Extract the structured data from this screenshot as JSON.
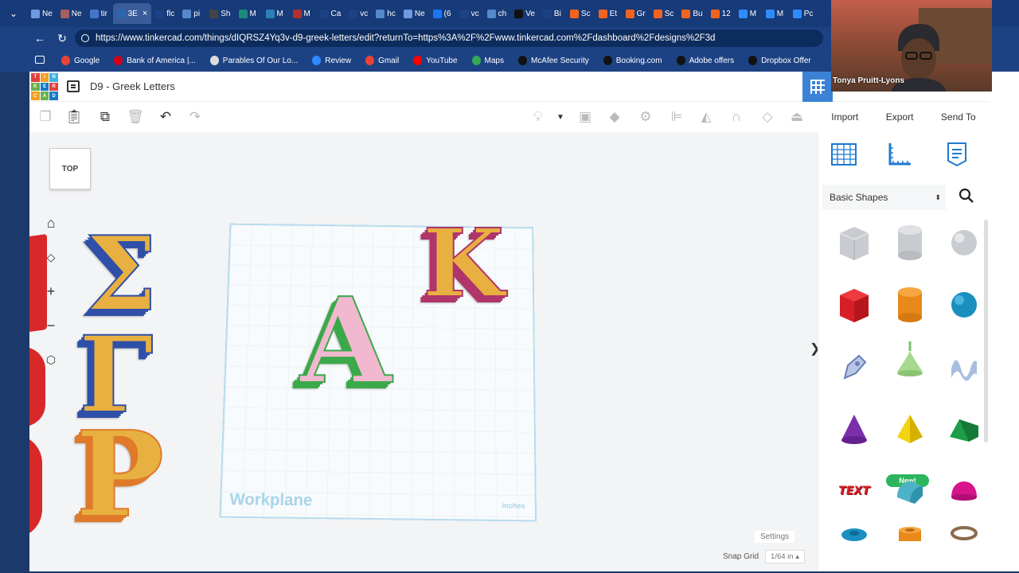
{
  "browser": {
    "tabs": [
      {
        "label": "Ne",
        "color": "#6d9ae0"
      },
      {
        "label": "Ne",
        "color": "#a85f5f"
      },
      {
        "label": "tir",
        "color": "#4477cc"
      },
      {
        "label": "3E",
        "color": "#2b66b0",
        "active": true
      },
      {
        "label": "flc",
        "color": "#1d4284"
      },
      {
        "label": "pi",
        "color": "#5588cc"
      },
      {
        "label": "Sh",
        "color": "#444444"
      },
      {
        "label": "M",
        "color": "#1b8a7a"
      },
      {
        "label": "M",
        "color": "#2a7fb8"
      },
      {
        "label": "M",
        "color": "#b33030"
      },
      {
        "label": "Ca",
        "color": "#1d4284"
      },
      {
        "label": "vc",
        "color": "#1d4284"
      },
      {
        "label": "hc",
        "color": "#5588cc"
      },
      {
        "label": "Ne",
        "color": "#6d9ae0"
      },
      {
        "label": "(6",
        "color": "#1877f2"
      },
      {
        "label": "vc",
        "color": "#1d4284"
      },
      {
        "label": "ch",
        "color": "#5588cc"
      },
      {
        "label": "Ve",
        "color": "#111111"
      },
      {
        "label": "Bi",
        "color": "#1d4284"
      },
      {
        "label": "Sc",
        "color": "#f1641e"
      },
      {
        "label": "Et",
        "color": "#f1641e"
      },
      {
        "label": "Gr",
        "color": "#f1641e"
      },
      {
        "label": "Sc",
        "color": "#f1641e"
      },
      {
        "label": "Bu",
        "color": "#f1641e"
      },
      {
        "label": "12",
        "color": "#f1641e"
      },
      {
        "label": "M",
        "color": "#2d8cff"
      },
      {
        "label": "M",
        "color": "#2d8cff"
      },
      {
        "label": "Pc",
        "color": "#2d8cff"
      }
    ],
    "tab_close": "×",
    "url": "https://www.tinkercad.com/things/dIQRSZ4Yq3v-d9-greek-letters/edit?returnTo=https%3A%2F%2Fwww.tinkercad.com%2Fdashboard%2Fdesigns%2F3d",
    "bookmarks": [
      {
        "label": "Google",
        "color": "#ea4335"
      },
      {
        "label": "Bank of America |...",
        "color": "#d4001a"
      },
      {
        "label": "Parables Of Our Lo...",
        "color": "#dddddd"
      },
      {
        "label": "Review",
        "color": "#2d8cff"
      },
      {
        "label": "Gmail",
        "color": "#ea4335"
      },
      {
        "label": "YouTube",
        "color": "#ff0000"
      },
      {
        "label": "Maps",
        "color": "#34a853"
      },
      {
        "label": "McAfee Security",
        "color": "#111111"
      },
      {
        "label": "Booking.com",
        "color": "#111111"
      },
      {
        "label": "Adobe offers",
        "color": "#111111"
      },
      {
        "label": "Dropbox Offer",
        "color": "#111111"
      }
    ]
  },
  "app": {
    "logo_letters": [
      "TIN",
      "KER",
      "CAD"
    ],
    "logo_colors": [
      "#e2403c",
      "#f4a020",
      "#3cb1e4",
      "#6ab04c",
      "#1479c9",
      "#e2403c",
      "#f4a020",
      "#6ab04c",
      "#1479c9"
    ],
    "design_title": "D9 - Greek Letters",
    "side_actions": [
      "Import",
      "Export",
      "Send To"
    ],
    "accent": "#3b82d6"
  },
  "viewport": {
    "viewcube_label": "TOP",
    "workplane_label": "Workplane",
    "units_label": "inches",
    "settings_label": "Settings",
    "snap_label": "Snap Grid",
    "snap_value": "1/64 in",
    "letters": [
      {
        "char": "Σ",
        "face": "#e8b040",
        "side": "#2f4fa8"
      },
      {
        "char": "Γ",
        "face": "#e8b040",
        "side": "#2f4fa8"
      },
      {
        "char": "Ρ",
        "face": "#e8b040",
        "side": "#e07a2a"
      },
      {
        "char": "Α",
        "face": "#f2b8d0",
        "side": "#3aa94a"
      },
      {
        "char": "Κ",
        "face": "#e8b040",
        "side": "#b0356a"
      }
    ]
  },
  "panel": {
    "library_label": "Basic Shapes",
    "new_badge": "New!",
    "text_shape_label": "TEXT"
  },
  "webcam": {
    "name": "Tonya Pruitt-Lyons"
  }
}
